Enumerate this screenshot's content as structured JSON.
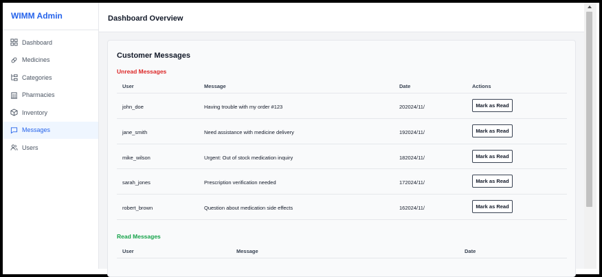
{
  "app": {
    "brand": "WIMM Admin"
  },
  "sidebar": {
    "items": [
      {
        "label": "Dashboard",
        "icon": "grid-icon",
        "active": false
      },
      {
        "label": "Medicines",
        "icon": "pill-icon",
        "active": false
      },
      {
        "label": "Categories",
        "icon": "category-tree-icon",
        "active": false
      },
      {
        "label": "Pharmacies",
        "icon": "building-icon",
        "active": false
      },
      {
        "label": "Inventory",
        "icon": "box-icon",
        "active": false
      },
      {
        "label": "Messages",
        "icon": "message-icon",
        "active": true
      },
      {
        "label": "Users",
        "icon": "users-icon",
        "active": false
      }
    ]
  },
  "header": {
    "title": "Dashboard Overview"
  },
  "messages": {
    "title": "Customer Messages",
    "unread_label": "Unread Messages",
    "read_label": "Read Messages",
    "unread_columns": [
      "User",
      "Message",
      "Date",
      "Actions"
    ],
    "read_columns": [
      "User",
      "Message",
      "Date"
    ],
    "action_label": "Mark as Read",
    "unread": [
      {
        "user": "john_doe",
        "message": "Having trouble with my order #123",
        "date": "202024/11/"
      },
      {
        "user": "jane_smith",
        "message": "Need assistance with medicine delivery",
        "date": "192024/11/"
      },
      {
        "user": "mike_wilson",
        "message": "Urgent: Out of stock medication inquiry",
        "date": "182024/11/"
      },
      {
        "user": "sarah_jones",
        "message": "Prescription verification needed",
        "date": "172024/11/"
      },
      {
        "user": "robert_brown",
        "message": "Question about medication side effects",
        "date": "162024/11/"
      }
    ]
  },
  "colors": {
    "brand": "#2563eb",
    "unread": "#dc2626",
    "read": "#16a34a",
    "active_bg": "#eff6ff"
  }
}
